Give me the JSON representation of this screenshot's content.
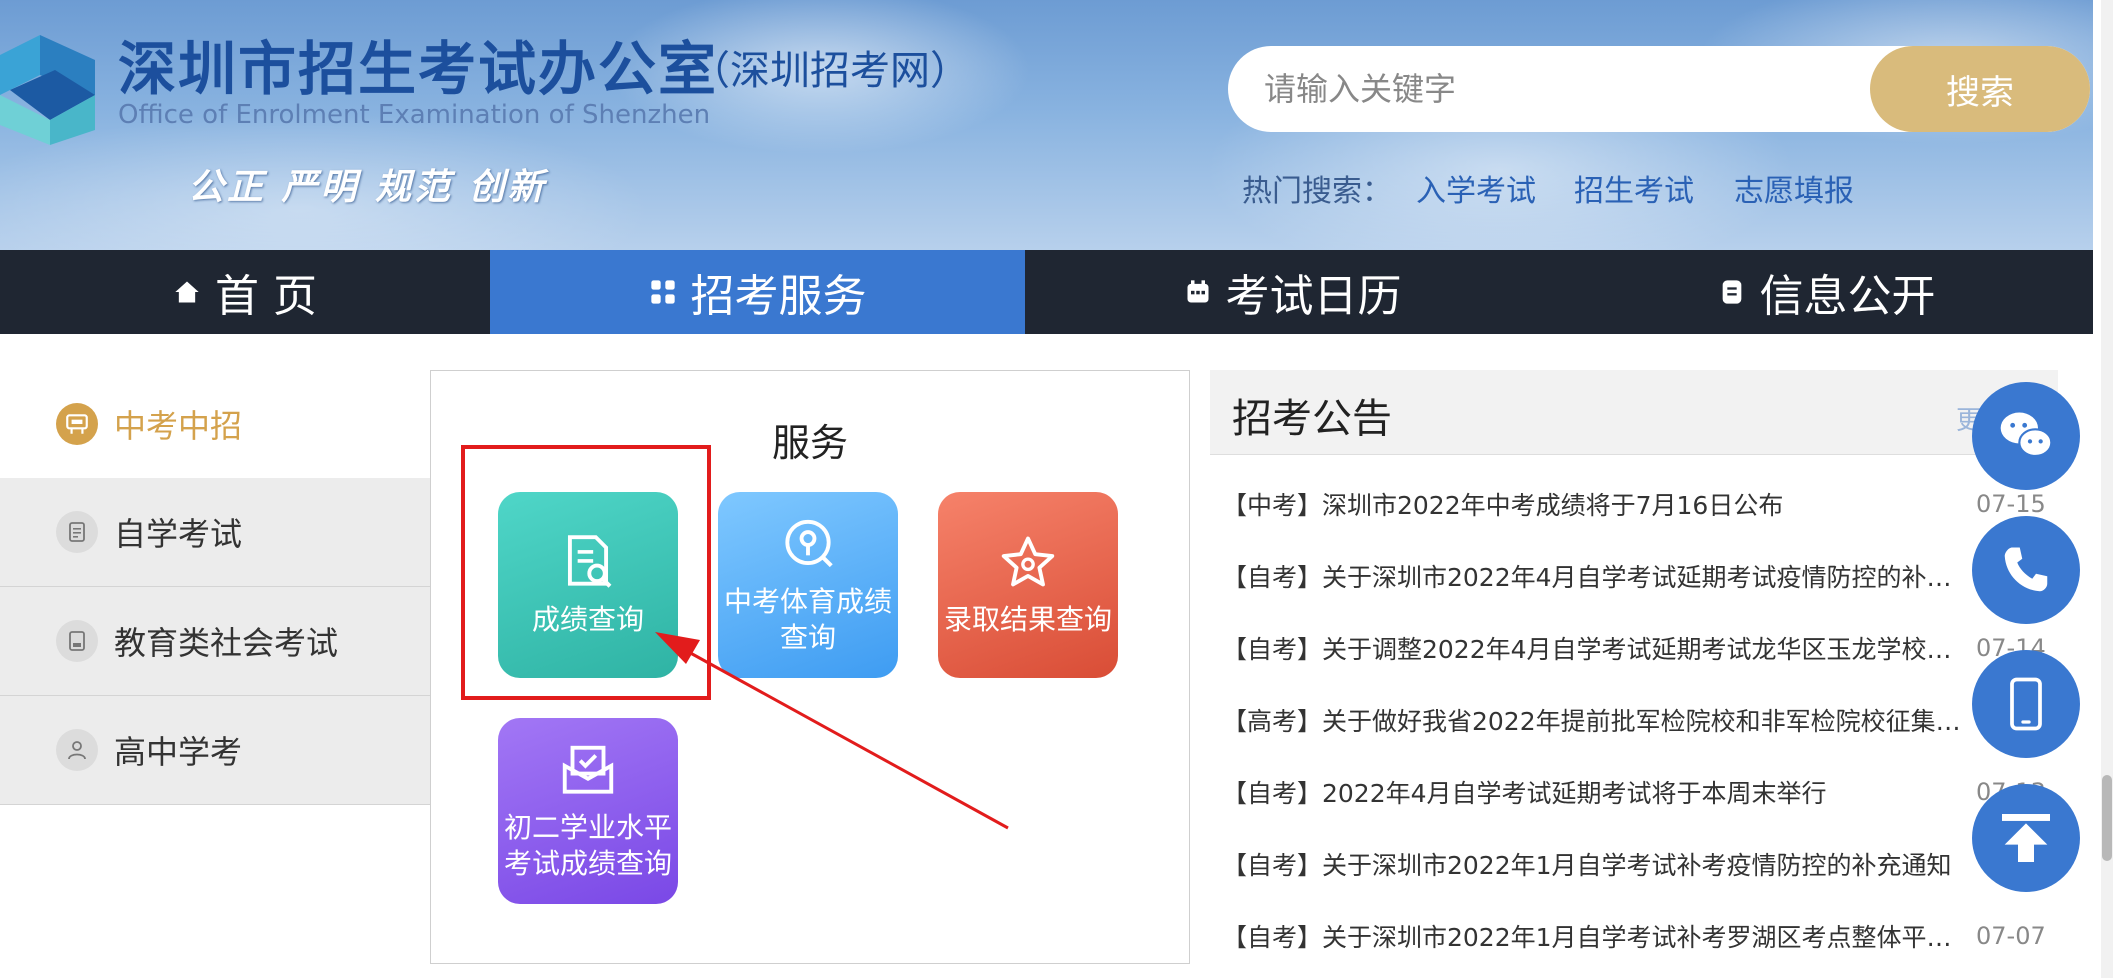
{
  "header": {
    "title": "深圳市招生考试办公室",
    "subtitle": "（深圳招考网）",
    "english": "Office of Enrolment Examination of Shenzhen",
    "motto": "公正 严明 规范 创新"
  },
  "search": {
    "placeholder": "请输入关键字",
    "button": "搜索",
    "hot_label": "热门搜索：",
    "hot_links": [
      "入学考试",
      "招生考试",
      "志愿填报"
    ]
  },
  "nav": {
    "items": [
      {
        "label": "首 页",
        "icon": "home-icon"
      },
      {
        "label": "招考服务",
        "icon": "grid-icon",
        "active": true
      },
      {
        "label": "考试日历",
        "icon": "calendar-icon"
      },
      {
        "label": "信息公开",
        "icon": "document-icon"
      }
    ]
  },
  "menu": {
    "items": [
      {
        "label": "中考中招",
        "icon": "school-sign-icon",
        "active": true
      },
      {
        "label": "自学考试",
        "icon": "notebook-icon"
      },
      {
        "label": "教育类社会考试",
        "icon": "tablet-icon"
      },
      {
        "label": "高中学考",
        "icon": "person-icon"
      }
    ]
  },
  "services": {
    "title": "服务",
    "tiles": [
      {
        "label": "成绩查询",
        "icon": "document-search-icon"
      },
      {
        "label": "中考体育成绩查询",
        "icon": "location-search-icon"
      },
      {
        "label": "录取结果查询",
        "icon": "star-icon"
      },
      {
        "label": "初二学业水平考试成绩查询",
        "icon": "envelope-check-icon"
      }
    ]
  },
  "notices": {
    "title": "招考公告",
    "more": "更",
    "items": [
      {
        "text": "【中考】深圳市2022年中考成绩将于7月16日公布",
        "date": "07-15"
      },
      {
        "text": "【自考】关于深圳市2022年4月自学考试延期考试疫情防控的补充通知",
        "date": ""
      },
      {
        "text": "【自考】关于调整2022年4月自学考试延期考试龙华区玉龙学校、潜...",
        "date": "07-14"
      },
      {
        "text": "【高考】关于做好我省2022年提前批军检院校和非军检院校征集志愿...",
        "date": ""
      },
      {
        "text": "【自考】2022年4月自学考试延期考试将于本周末举行",
        "date": "07-13"
      },
      {
        "text": "【自考】关于深圳市2022年1月自学考试补考疫情防控的补充通知",
        "date": ""
      },
      {
        "text": "【自考】关于深圳市2022年1月自学考试补考罗湖区考点整体平移的...",
        "date": "07-07"
      }
    ]
  },
  "floating": [
    "wechat-icon",
    "phone-icon",
    "mobile-icon",
    "back-to-top-icon"
  ],
  "colors": {
    "nav_bg": "#1f2632",
    "nav_active": "#3a78d0",
    "search_button": "#d9bb7c",
    "menu_active_text": "#d4a24c",
    "highlight": "#e21c1c"
  }
}
